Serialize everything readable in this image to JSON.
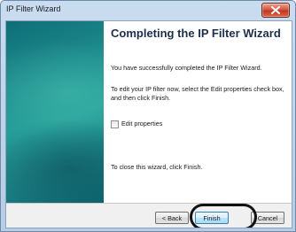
{
  "window": {
    "title": "IP Filter Wizard"
  },
  "wizard": {
    "heading": "Completing the IP Filter Wizard",
    "success_text": "You have successfully completed the IP Filter Wizard.",
    "edit_instructions": "To edit your IP filter now, select the Edit properties check box, and then click Finish.",
    "edit_properties": {
      "label": "Edit properties",
      "checked": false
    },
    "close_instructions": "To close this wizard, click Finish."
  },
  "buttons": {
    "back": "< Back",
    "finish": "Finish",
    "cancel": "Cancel"
  },
  "icons": {
    "close": "close-icon"
  },
  "colors": {
    "accent_panel": "#1d8a8c",
    "close_button": "#d5563f",
    "heading": "#1d2f4b",
    "highlight_ring": "#111111"
  }
}
